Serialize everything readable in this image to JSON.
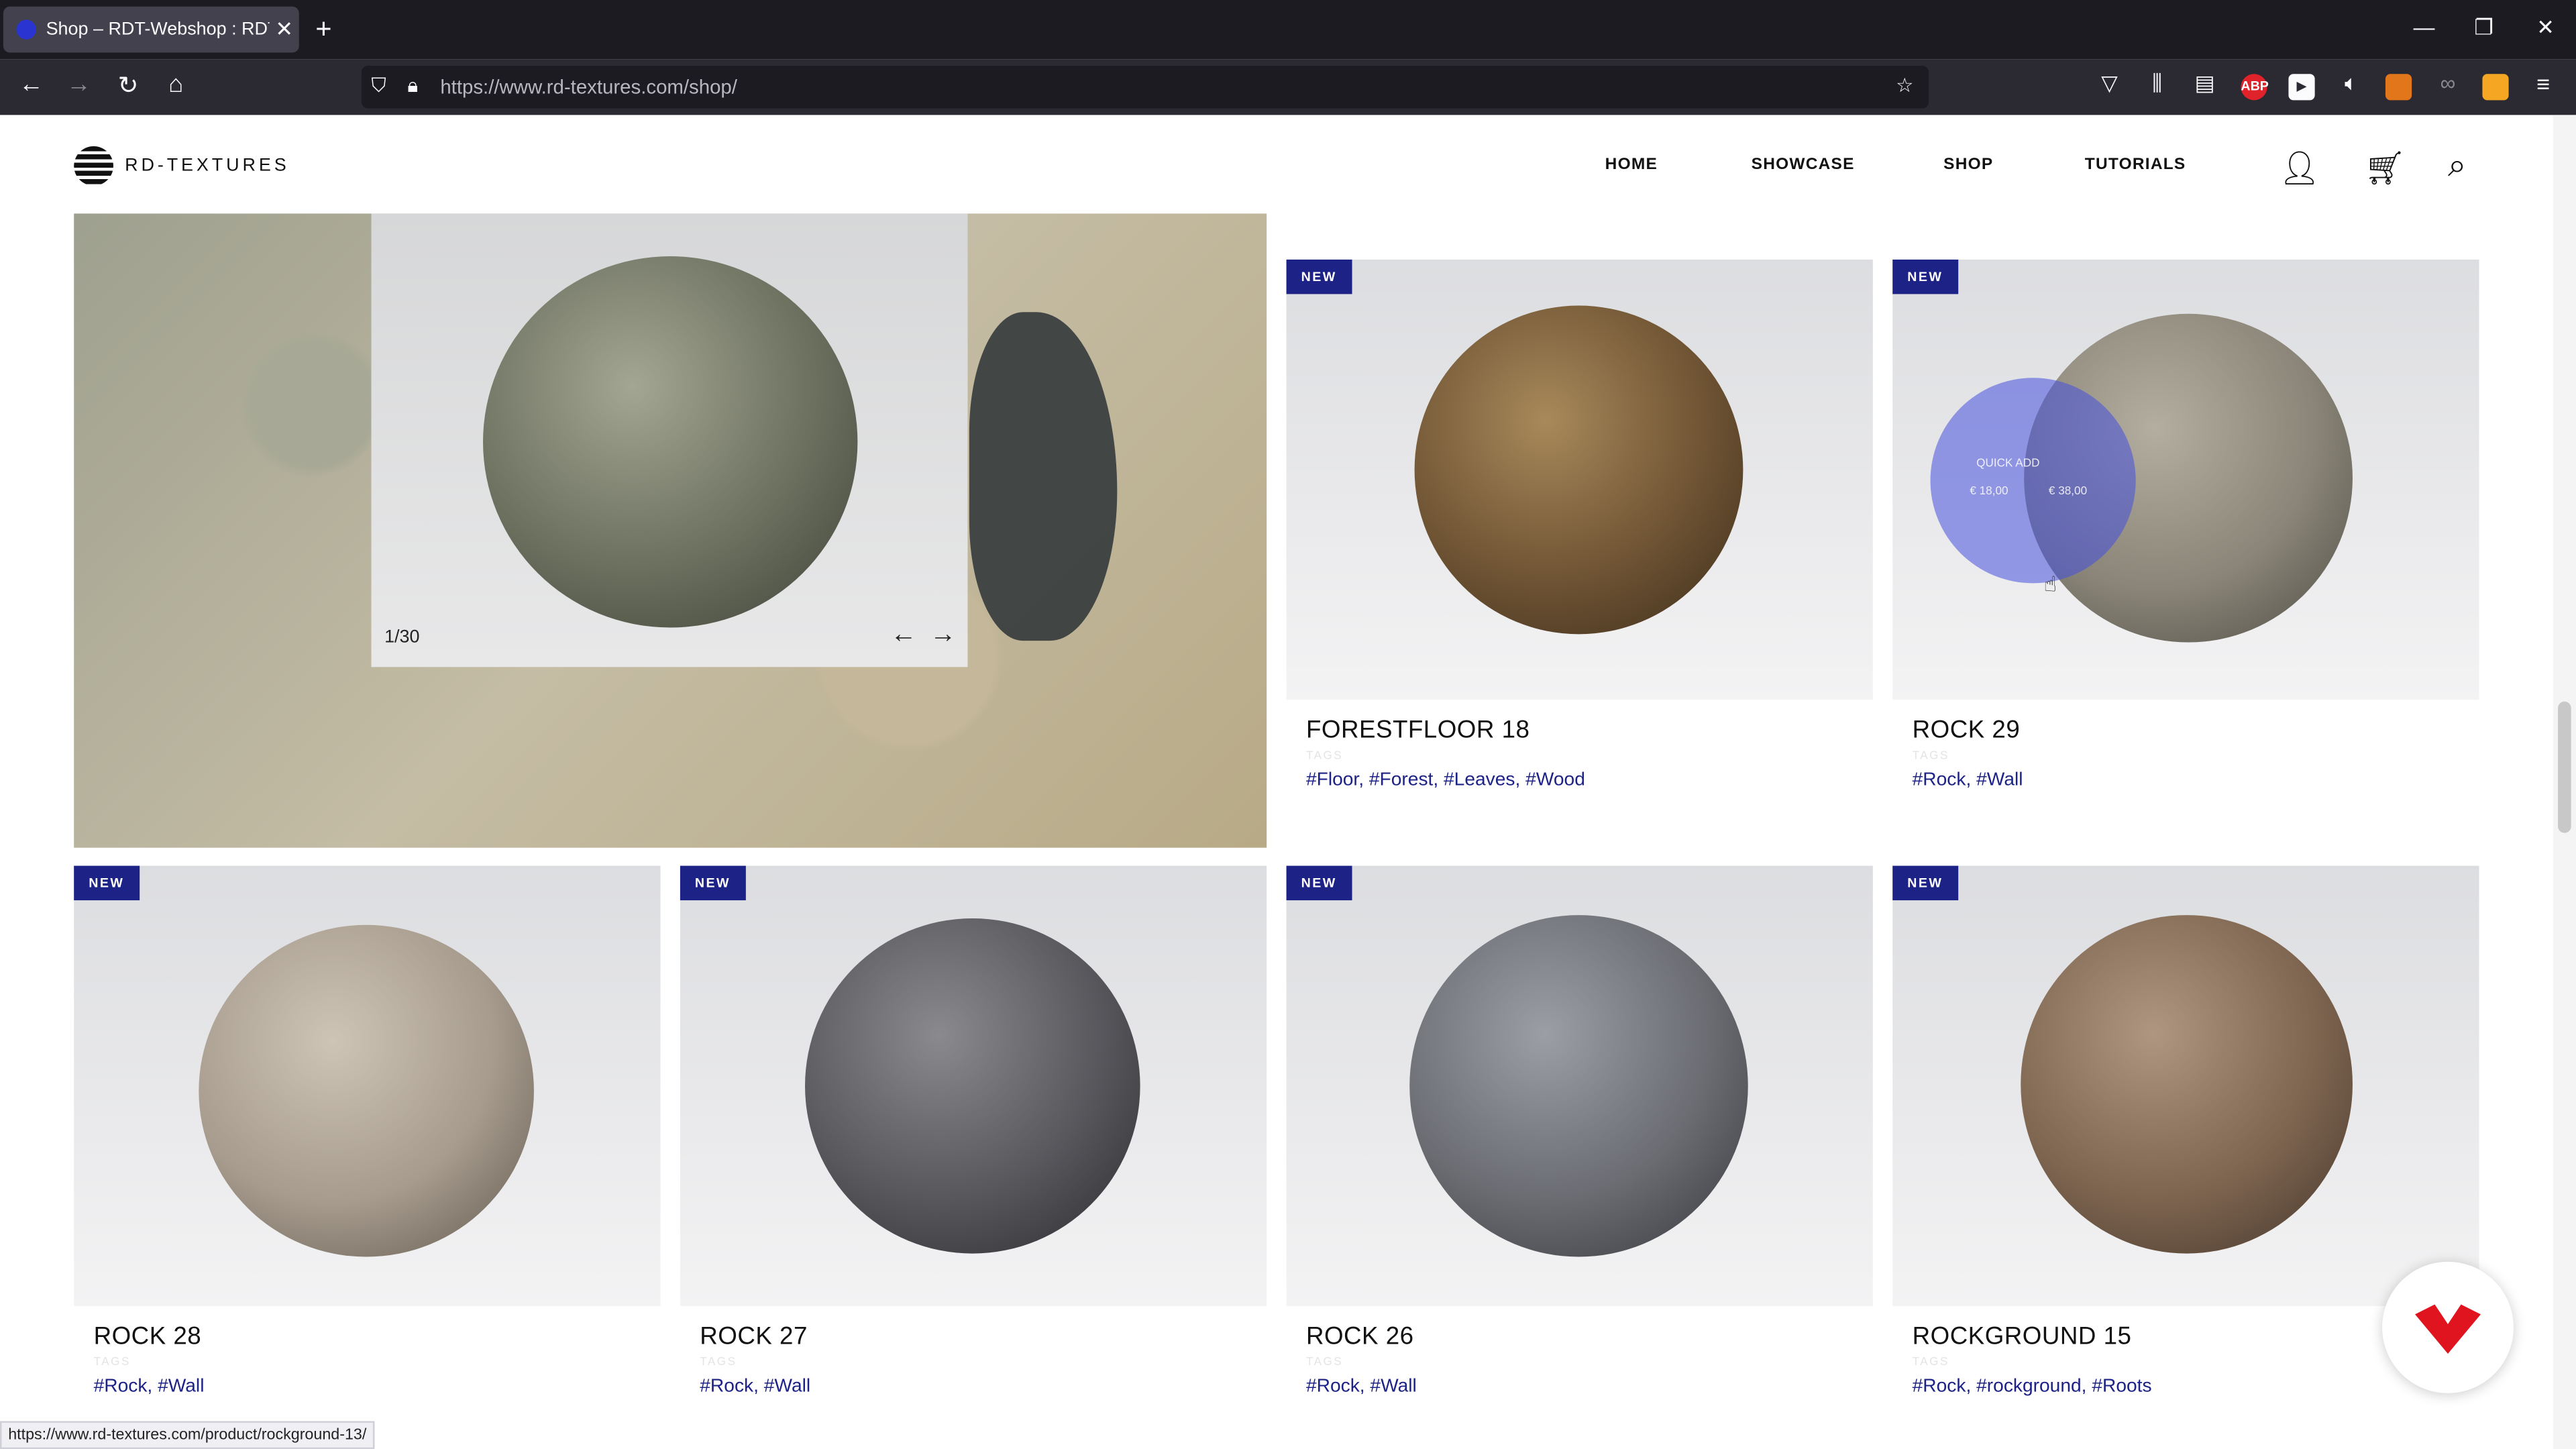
{
  "browser": {
    "tab_title": "Shop – RDT-Webshop : RDT-We",
    "url": "https://www.rd-textures.com/shop/",
    "status_url": "https://www.rd-textures.com/product/rockground-13/",
    "ext_abp": "ABP"
  },
  "site": {
    "logo_text": "RD-TEXTURES",
    "menu": [
      "HOME",
      "SHOWCASE",
      "SHOP",
      "TUTORIALS"
    ]
  },
  "feature": {
    "counter": "1/30"
  },
  "quick_add": {
    "label": "QUICK ADD",
    "price_low": "€ 18,00",
    "price_high": "€ 38,00"
  },
  "badge_text": "NEW",
  "tags_label": "TAGS",
  "products": [
    {
      "name": "FORESTFLOOR 18",
      "tags": "#Floor, #Forest, #Leaves, #Wood",
      "color": "#6f5434"
    },
    {
      "name": "ROCK 29",
      "tags": "#Rock, #Wall",
      "color": "#8a8578"
    },
    {
      "name": "ROCK 28",
      "tags": "#Rock, #Wall",
      "color": "#a69b8d"
    },
    {
      "name": "ROCK 27",
      "tags": "#Rock, #Wall",
      "color": "#57575c"
    },
    {
      "name": "ROCK 26",
      "tags": "#Rock, #Wall",
      "color": "#6a6c72"
    },
    {
      "name": "ROCKGROUND 15",
      "tags": "#Rock, #rockground, #Roots",
      "color": "#7e6550"
    }
  ]
}
